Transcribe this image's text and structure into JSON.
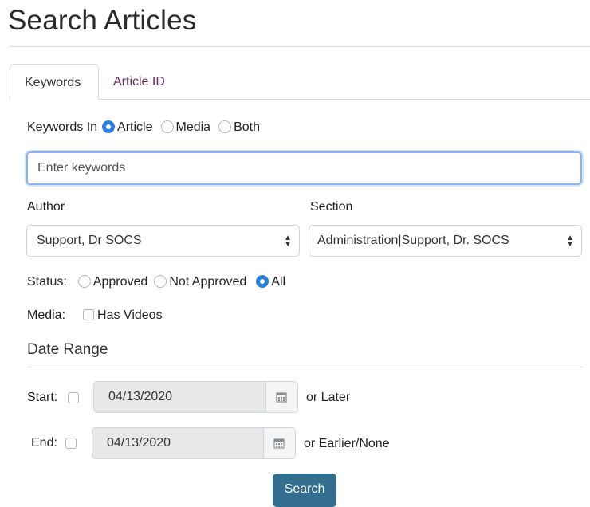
{
  "page": {
    "title": "Search Articles"
  },
  "tabs": [
    {
      "label": "Keywords",
      "active": true
    },
    {
      "label": "Article ID",
      "active": false
    }
  ],
  "keywords_in": {
    "label": "Keywords In",
    "options": [
      "Article",
      "Media",
      "Both"
    ],
    "selected": "Article"
  },
  "keywords_input": {
    "placeholder": "Enter keywords",
    "value": ""
  },
  "author": {
    "label": "Author",
    "value": "Support, Dr SOCS"
  },
  "section": {
    "label": "Section",
    "value": "Administration|Support, Dr. SOCS"
  },
  "status": {
    "label": "Status:",
    "options": [
      "Approved",
      "Not Approved",
      "All"
    ],
    "selected": "All"
  },
  "media": {
    "label": "Media:",
    "checkbox_label": "Has Videos",
    "checked": false
  },
  "date_range": {
    "heading": "Date Range",
    "start": {
      "label": "Start:",
      "value": "04/13/2020",
      "suffix": "or Later",
      "checked": false
    },
    "end": {
      "label": "End:",
      "value": "04/13/2020",
      "suffix": "or Earlier/None",
      "checked": false
    }
  },
  "search_button": {
    "label": "Search"
  },
  "colors": {
    "accent": "#2a7de1",
    "tab_link": "#6b2b5f",
    "button": "#336e8f"
  }
}
